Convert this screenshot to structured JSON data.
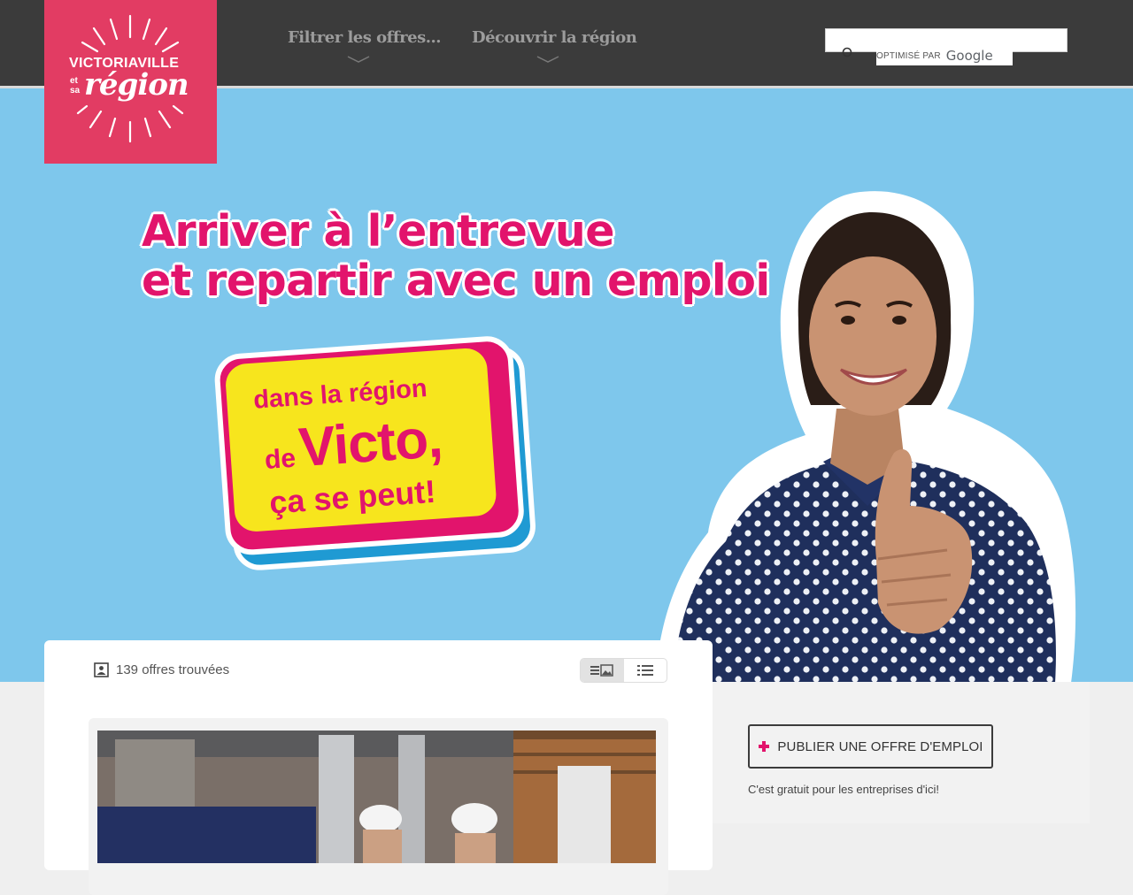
{
  "brand": {
    "logo_line1": "VICTORIAVILLE",
    "logo_small1": "et",
    "logo_small2": "sa",
    "logo_line2": "région",
    "color": "#e23c63"
  },
  "nav": {
    "items": [
      {
        "label": "Filtrer les offres..."
      },
      {
        "label": "Découvrir la région"
      }
    ]
  },
  "search": {
    "powered_prefix": "OPTIMISÉ PAR",
    "powered_brand": "Google"
  },
  "hero": {
    "title_line1": "Arriver à l’entrevue",
    "title_line2": "et repartir avec un emploi",
    "sticker_line1": "dans la région",
    "sticker_de": "de",
    "sticker_victo": "Victo,",
    "sticker_line3": "ça se peut!",
    "accent": "#e2146c",
    "yellow": "#f7e51d",
    "sky": "#7ec7ec"
  },
  "results": {
    "count_text": "139 offres trouvées"
  },
  "sidebar": {
    "publish_label": "PUBLIER UNE OFFRE D'EMPLOI",
    "publish_note": "C'est gratuit pour les entreprises d'ici!"
  }
}
